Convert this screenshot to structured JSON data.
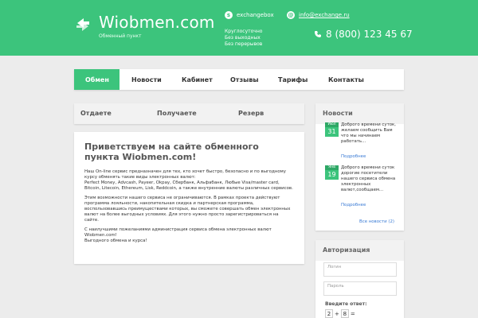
{
  "header": {
    "logo_title": "Wiobmen.com",
    "logo_subtitle": "Обменный пункт",
    "skype": "exchangebox",
    "email": "info@exchange.ru",
    "hours": [
      "Круглосуточно",
      "Без выходных",
      "Без перерывов"
    ],
    "phone": "8 (800) 123 45 67"
  },
  "nav": {
    "items": [
      "Обмен",
      "Новости",
      "Кабинет",
      "Отзывы",
      "Тарифы",
      "Контакты"
    ]
  },
  "rates": {
    "give": "Отдаете",
    "get": "Получаете",
    "reserve": "Резерв"
  },
  "welcome": {
    "title": "Приветствуем на сайте обменного пункта Wiobmen.com!",
    "p1": "Наш On-line сервис предназначен для тех, кто хочет быстро, безопасно и по выгодному курсу обменять такие виды электронных валют:\nPerfect Money, Advcash, Payeer, Okpay, Сбербанк, Альфабанк, Любые Visa/master card, Bitcoin, Litecoin, Ethereum, Lisk, Reddcoin, а также внутренние валюты различных сервисов.",
    "p2": "Этим возможности нашего сервиса не ограничиваются. В рамках проекта действуют программа лояльности, накопительная скидка и партнерская программа, воспользовавшись преимуществами которых, вы сможете совершать обмен электронных валют на более выгодных условиях. Для этого нужно просто зарегистрироваться на сайте.",
    "p3": "С наилучшими пожеланиями администрация сервиса обмена электронных валют Wiobmen.com!\nВыгодного обмена и курса!"
  },
  "news": {
    "title": "Новости",
    "items": [
      {
        "month": "Июл",
        "day": "31",
        "text": "Доброго времени суток, желаем сообщить Вам что мы начинаем работать...",
        "more": "Подробнее"
      },
      {
        "month": "Янв",
        "day": "19",
        "text": "Доброго времени суток дорогие посетители нашего сервиса обмена электронных валют,сообщаем...",
        "more": "Подробнее"
      }
    ],
    "all": "Все новости (2)"
  },
  "auth": {
    "title": "Авторизация",
    "login_placeholder": "Логин",
    "password_placeholder": "Пароль",
    "captcha_label": "Введите ответ:",
    "captcha_a": "2",
    "captcha_op": "+",
    "captcha_b": "8",
    "captcha_eq": "="
  },
  "colors": {
    "accent": "#3cc47c",
    "link": "#3a7bd5"
  }
}
